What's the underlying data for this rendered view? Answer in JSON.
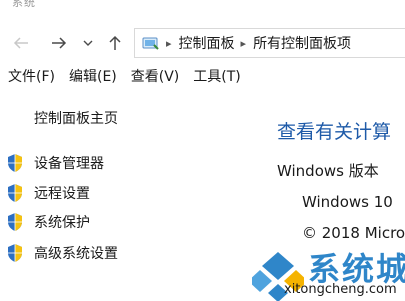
{
  "window": {
    "title_fragment": "系统"
  },
  "address_bar": {
    "crumbs": [
      "控制面板",
      "所有控制面板项"
    ]
  },
  "menu": {
    "items": [
      "文件(F)",
      "编辑(E)",
      "查看(V)",
      "工具(T)"
    ]
  },
  "sidebar": {
    "home": "控制面板主页",
    "tasks": [
      {
        "label": "设备管理器",
        "icon": "uac-shield-icon"
      },
      {
        "label": "远程设置",
        "icon": "uac-shield-icon"
      },
      {
        "label": "系统保护",
        "icon": "uac-shield-icon"
      },
      {
        "label": "高级系统设置",
        "icon": "uac-shield-icon"
      }
    ]
  },
  "main": {
    "heading": "查看有关计算",
    "edition_label": "Windows 版本",
    "edition_name": "Windows 10",
    "copyright": "© 2018 Micro"
  },
  "watermark": {
    "brand": "系统城",
    "url": "xitongcheng.com"
  },
  "colors": {
    "link_blue": "#1e5aa8",
    "watermark_blue": "#2f86c9"
  }
}
